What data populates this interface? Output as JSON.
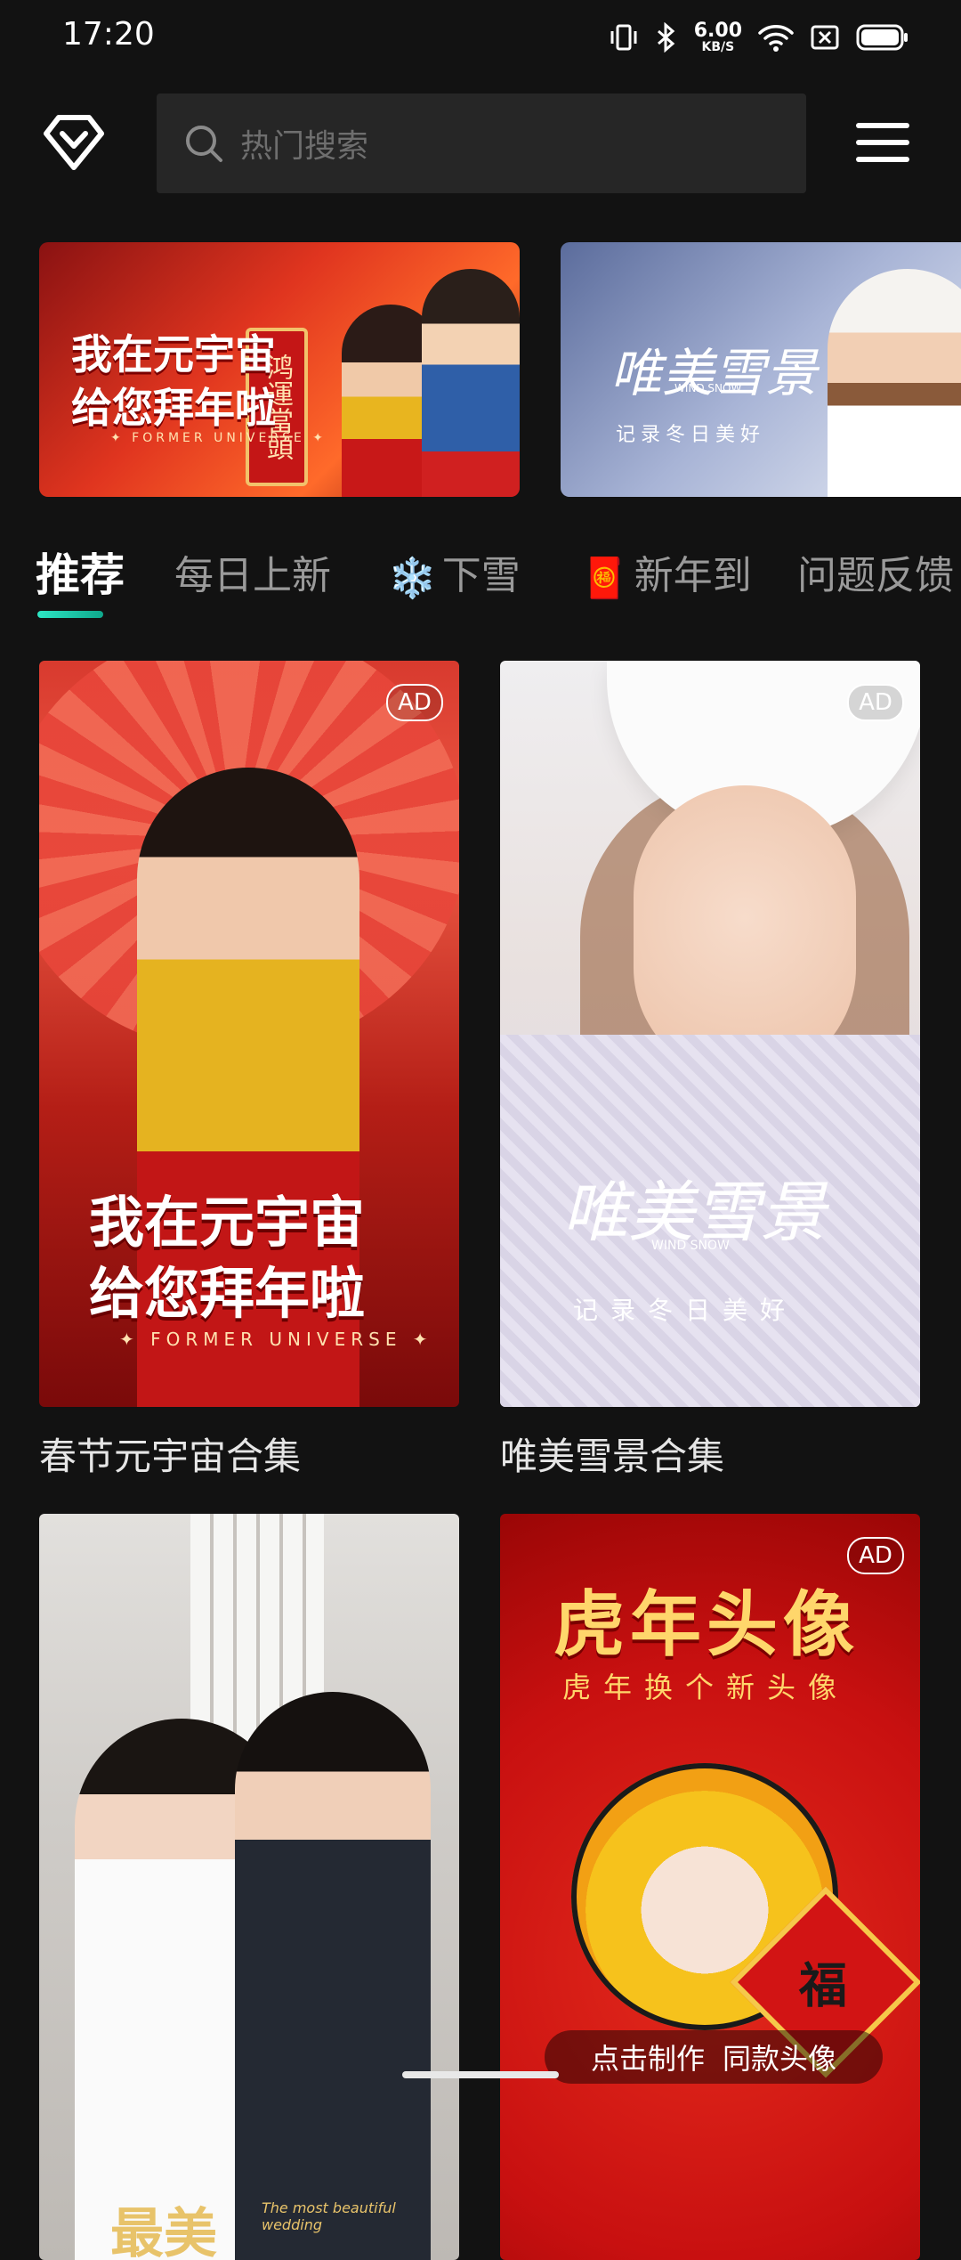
{
  "status_bar": {
    "time": "17:20",
    "net_speed_value": "6.00",
    "net_speed_unit": "KB/S",
    "icons": [
      "vibrate-icon",
      "bluetooth-icon",
      "wifi-icon",
      "sim-off-icon",
      "battery-icon"
    ]
  },
  "header": {
    "logo_icon": "diamond-heart-logo-icon",
    "search_placeholder": "热门搜索",
    "menu_icon": "hamburger-menu-icon"
  },
  "banners": [
    {
      "title_line1": "我在元宇宙",
      "title_line2": "给您拜年啦",
      "subtitle": "✦ FORMER UNIVERSE ✦",
      "scroll_text": "鸿運當頭"
    },
    {
      "title": "唯美雪景",
      "english": "WIND SNOW",
      "subtitle": "记录冬日美好"
    }
  ],
  "tabs": [
    {
      "label": "推荐",
      "active": true
    },
    {
      "label": "每日上新",
      "active": false
    },
    {
      "label": "下雪",
      "emoji": "❄️",
      "active": false
    },
    {
      "label": "新年到",
      "emoji": "🧧",
      "active": false
    },
    {
      "label": "问题反馈",
      "active": false
    }
  ],
  "cards": [
    {
      "title": "春节元宇宙合集",
      "ad": "AD",
      "thumb_line1": "我在元宇宙",
      "thumb_line2": "给您拜年啦",
      "thumb_sub": "✦ FORMER UNIVERSE ✦"
    },
    {
      "title": "唯美雪景合集",
      "ad": "AD",
      "thumb_title": "唯美雪景",
      "thumb_english": "WIND SNOW",
      "thumb_sub": "记录冬日美好"
    },
    {
      "thumb_title": "最美",
      "thumb_script": "The most beautiful wedding"
    },
    {
      "ad": "AD",
      "thumb_title": "虎年头像",
      "thumb_sub": "虎年换个新头像",
      "fu": "福",
      "cta_left": "点击制作",
      "cta_right": "同款头像"
    }
  ],
  "colors": {
    "background": "#121212",
    "search_bg": "#262626",
    "tab_indicator": "#2de6c4",
    "tab_inactive": "#9a9a9a"
  }
}
